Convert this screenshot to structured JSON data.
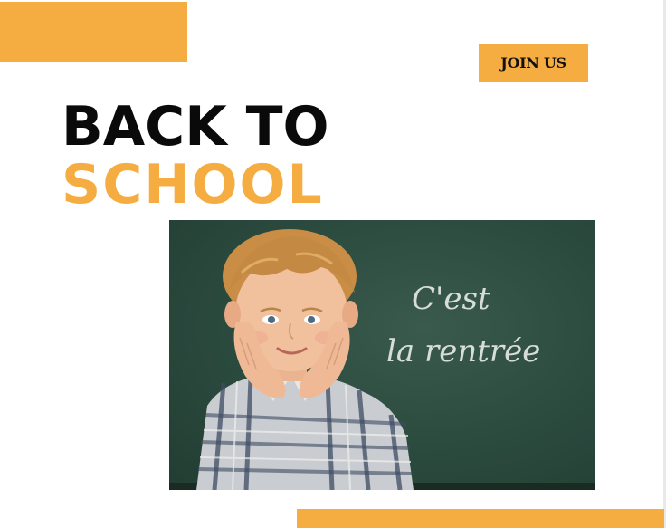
{
  "header": {
    "join_label": "JOIN US"
  },
  "headline": {
    "line1": "BACK TO",
    "line2": "SCHOOL"
  },
  "photo": {
    "chalk_line1": "C'est",
    "chalk_line2": "la rentrée"
  },
  "colors": {
    "accent": "#F5AD42",
    "headline_dark": "#0a0a0a",
    "chalkboard": "#2b4a3e"
  }
}
